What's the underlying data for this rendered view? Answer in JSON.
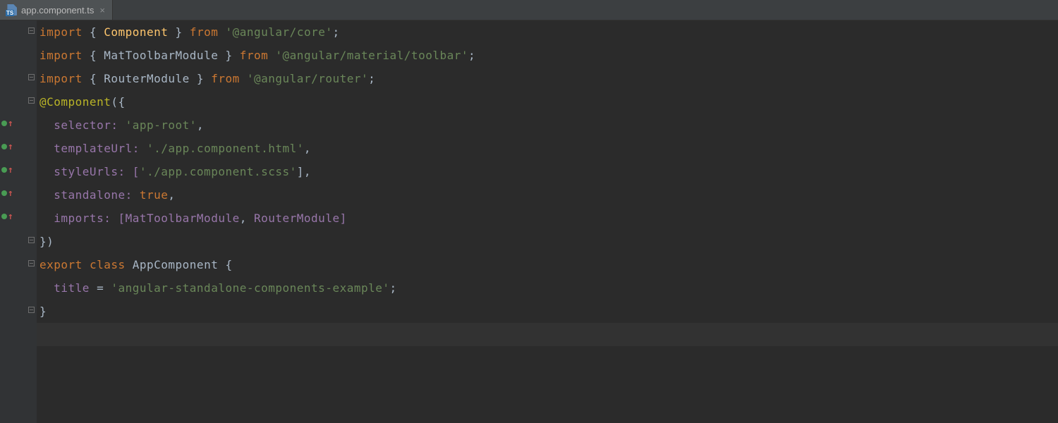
{
  "tab": {
    "filename": "app.component.ts",
    "close_glyph": "×"
  },
  "gutter": [
    {
      "vcs": false,
      "fold": "open"
    },
    {
      "vcs": false,
      "fold": null
    },
    {
      "vcs": false,
      "fold": "close"
    },
    {
      "vcs": false,
      "fold": "open"
    },
    {
      "vcs": true,
      "fold": null
    },
    {
      "vcs": true,
      "fold": null
    },
    {
      "vcs": true,
      "fold": null
    },
    {
      "vcs": true,
      "fold": null
    },
    {
      "vcs": true,
      "fold": null
    },
    {
      "vcs": false,
      "fold": "close"
    },
    {
      "vcs": false,
      "fold": "open"
    },
    {
      "vcs": false,
      "fold": null
    },
    {
      "vcs": false,
      "fold": "close"
    },
    {
      "vcs": false,
      "fold": null
    }
  ],
  "code": {
    "l1": {
      "a": "import ",
      "b": "{ ",
      "c": "Component",
      "d": " } ",
      "e": "from ",
      "f": "'@angular/core'",
      "g": ";"
    },
    "l2": {
      "a": "import ",
      "b": "{ MatToolbarModule } ",
      "c": "from ",
      "d": "'@angular/material/toolbar'",
      "e": ";"
    },
    "l3": {
      "a": "import ",
      "b": "{ RouterModule } ",
      "c": "from ",
      "d": "'@angular/router'",
      "e": ";"
    },
    "l4": {
      "a": "@Component",
      "b": "({"
    },
    "l5": {
      "indent": "  ",
      "a": "selector: ",
      "b": "'app-root'",
      "c": ","
    },
    "l6": {
      "indent": "  ",
      "a": "templateUrl: ",
      "b": "'./app.component.html'",
      "c": ","
    },
    "l7": {
      "indent": "  ",
      "a": "styleUrls: [",
      "b": "'./app.component.scss'",
      "c": "],"
    },
    "l8": {
      "indent": "  ",
      "a": "standalone: ",
      "b": "true",
      "c": ","
    },
    "l9": {
      "indent": "  ",
      "a": "imports: [MatToolbarModule",
      "b": ", ",
      "c": "RouterModule]"
    },
    "l10": {
      "a": "})"
    },
    "l11": {
      "a": "export ",
      "b": "class ",
      "c": "AppComponent ",
      "d": "{"
    },
    "l12": {
      "indent": "  ",
      "a": "title ",
      "b": "= ",
      "c": "'angular-standalone-components-example'",
      "d": ";"
    },
    "l13": {
      "a": "}"
    }
  },
  "highlight_line_index": 13
}
